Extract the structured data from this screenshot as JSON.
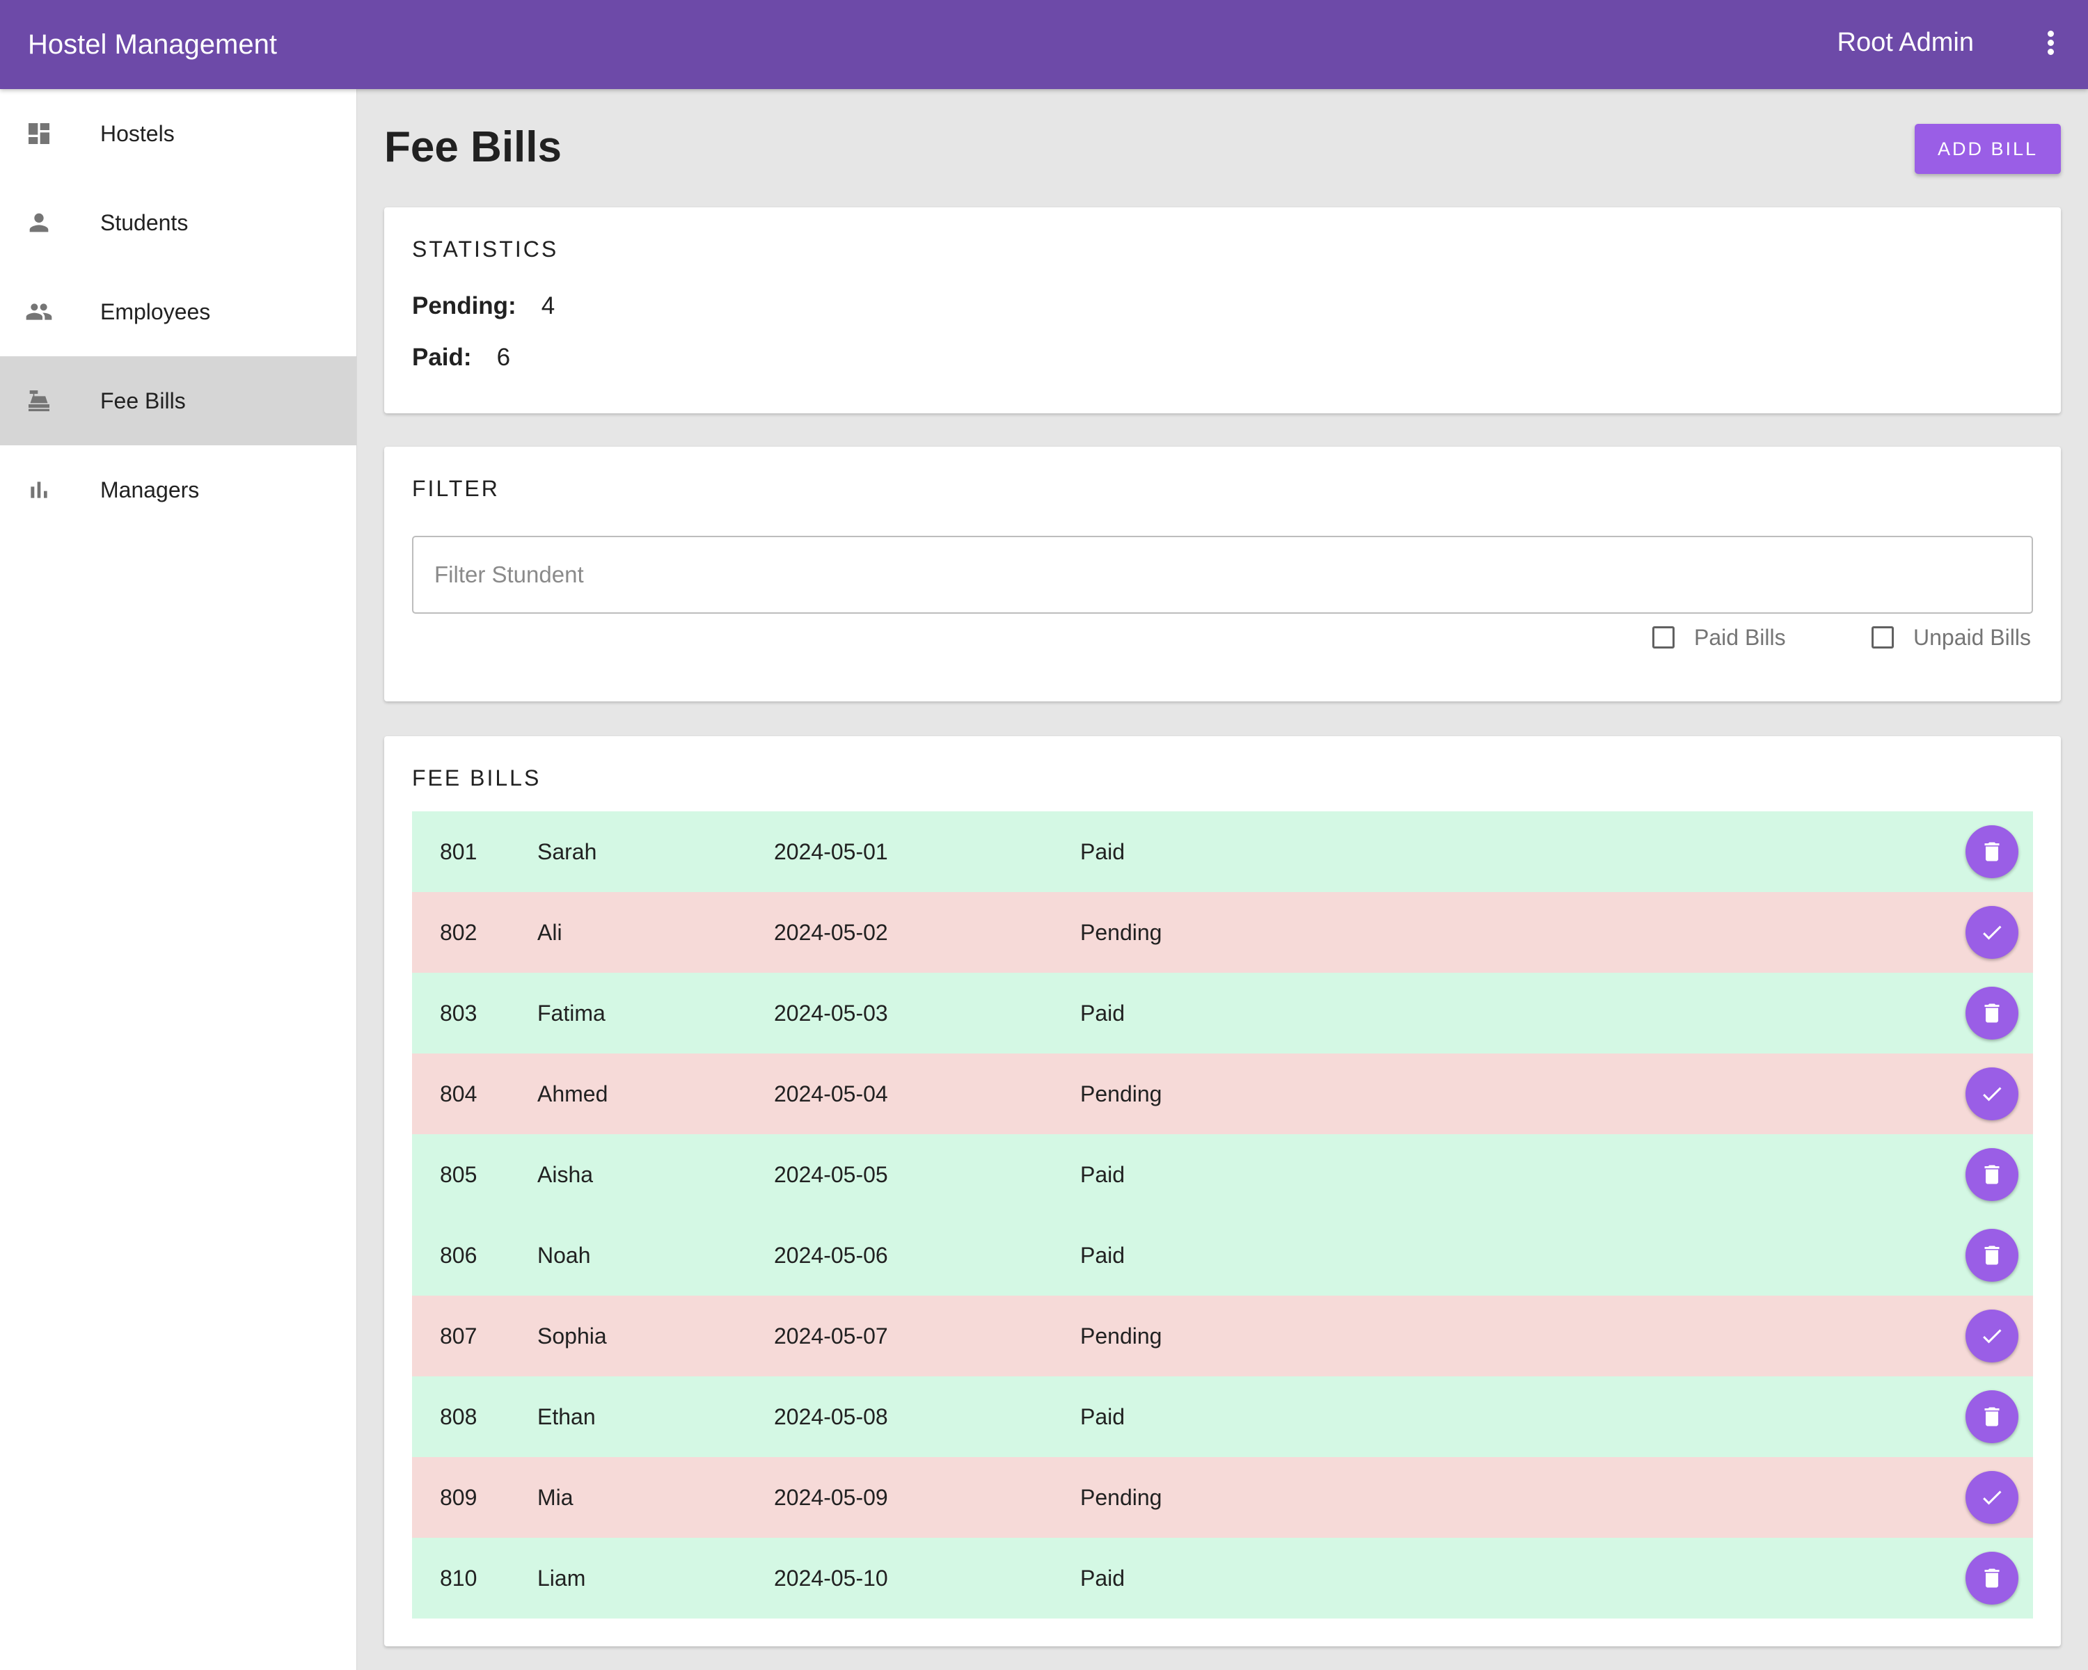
{
  "appbar": {
    "title": "Hostel Management",
    "user": "Root Admin",
    "menu_icon": "more-vert-icon",
    "color": "#6d4aa8"
  },
  "sidebar": {
    "items": [
      {
        "label": "Hostels",
        "icon": "dashboard-icon"
      },
      {
        "label": "Students",
        "icon": "person-icon"
      },
      {
        "label": "Employees",
        "icon": "people-icon"
      },
      {
        "label": "Fee Bills",
        "icon": "cash-register-icon",
        "active": true
      },
      {
        "label": "Managers",
        "icon": "bar-chart-icon"
      }
    ]
  },
  "main": {
    "title": "Fee Bills",
    "add_button": "ADD BILL",
    "accent": "#9a5ee6"
  },
  "statistics": {
    "heading": "STATISTICS",
    "pending_label": "Pending:",
    "pending_value": "4",
    "paid_label": "Paid:",
    "paid_value": "6"
  },
  "filter": {
    "heading": "FILTER",
    "placeholder": "Filter Stundent",
    "value": "",
    "paid_checkbox": "Paid Bills",
    "paid_checked": false,
    "unpaid_checkbox": "Unpaid Bills",
    "unpaid_checked": false
  },
  "bills": {
    "heading": "FEE BILLS",
    "paid_row_color": "#d4f8e4",
    "pending_row_color": "#f6dad8",
    "rows": [
      {
        "id": "801",
        "name": "Sarah",
        "date": "2024-05-01",
        "status": "Paid",
        "action": "delete-icon"
      },
      {
        "id": "802",
        "name": "Ali",
        "date": "2024-05-02",
        "status": "Pending",
        "action": "check-icon"
      },
      {
        "id": "803",
        "name": "Fatima",
        "date": "2024-05-03",
        "status": "Paid",
        "action": "delete-icon"
      },
      {
        "id": "804",
        "name": "Ahmed",
        "date": "2024-05-04",
        "status": "Pending",
        "action": "check-icon"
      },
      {
        "id": "805",
        "name": "Aisha",
        "date": "2024-05-05",
        "status": "Paid",
        "action": "delete-icon"
      },
      {
        "id": "806",
        "name": "Noah",
        "date": "2024-05-06",
        "status": "Paid",
        "action": "delete-icon"
      },
      {
        "id": "807",
        "name": "Sophia",
        "date": "2024-05-07",
        "status": "Pending",
        "action": "check-icon"
      },
      {
        "id": "808",
        "name": "Ethan",
        "date": "2024-05-08",
        "status": "Paid",
        "action": "delete-icon"
      },
      {
        "id": "809",
        "name": "Mia",
        "date": "2024-05-09",
        "status": "Pending",
        "action": "check-icon"
      },
      {
        "id": "810",
        "name": "Liam",
        "date": "2024-05-10",
        "status": "Paid",
        "action": "delete-icon"
      }
    ]
  }
}
